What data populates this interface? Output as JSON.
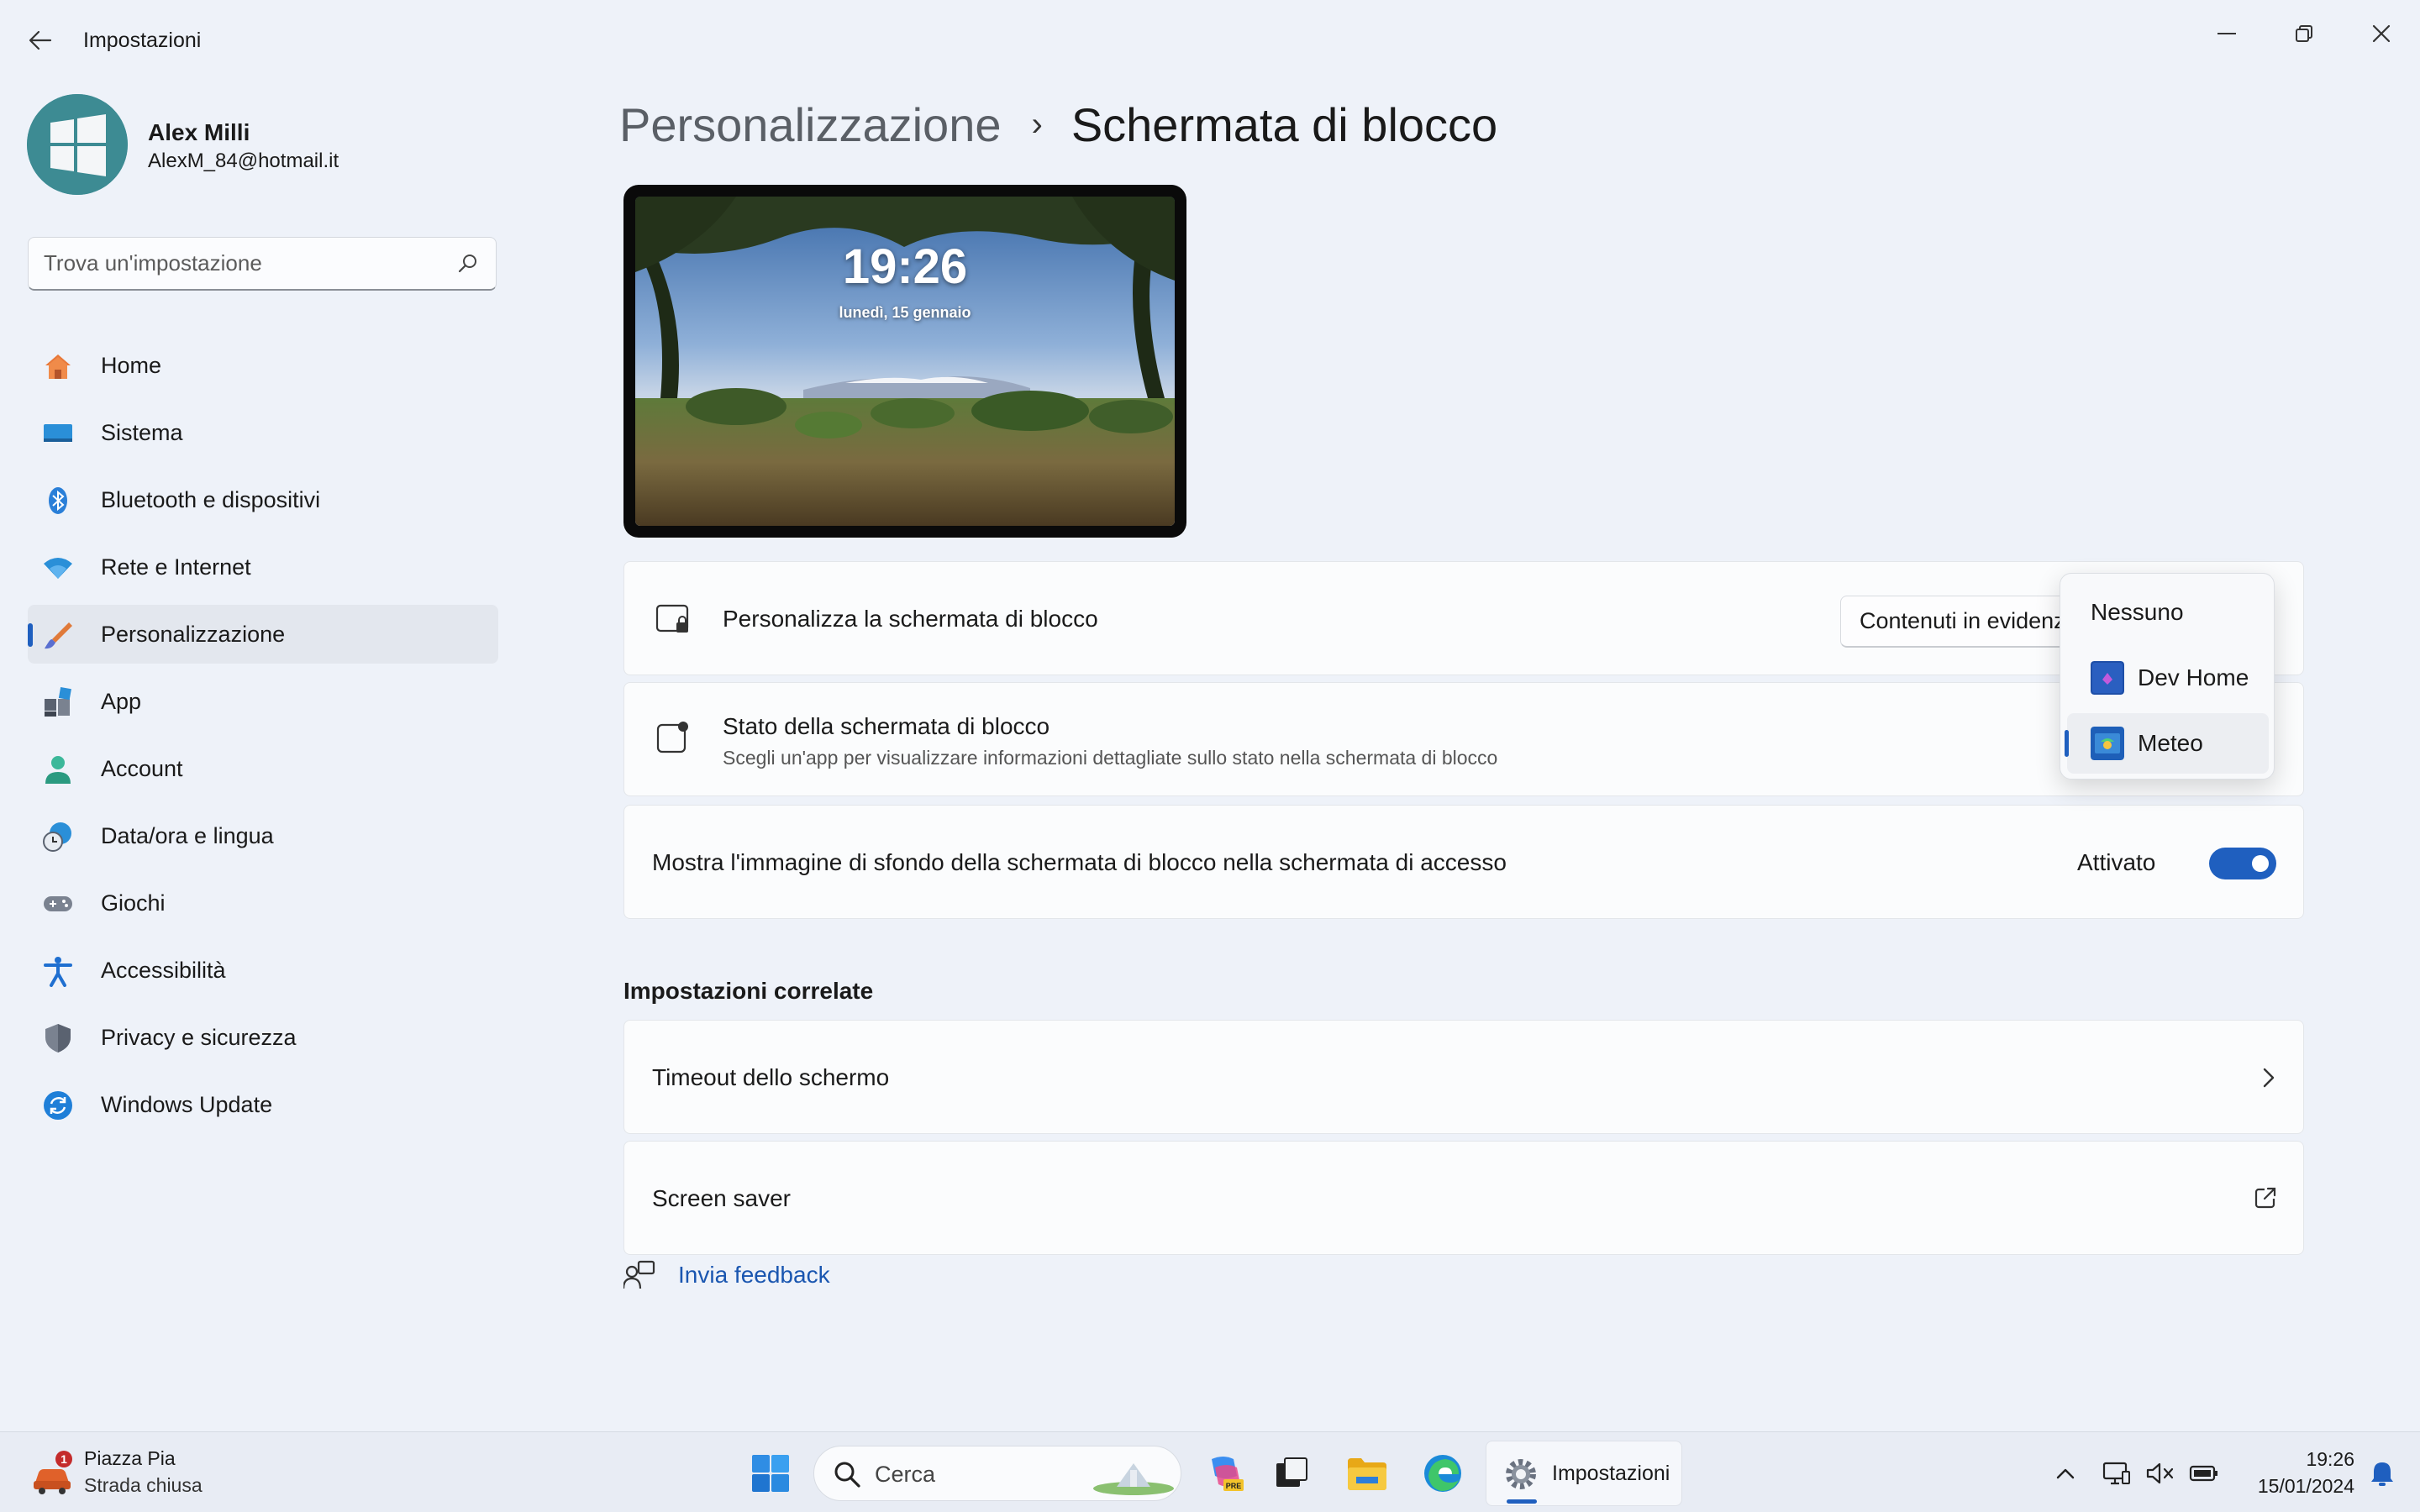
{
  "window": {
    "title": "Impostazioni",
    "controls": [
      "minimize",
      "restore",
      "close"
    ]
  },
  "profile": {
    "name": "Alex Milli",
    "email": "AlexM_84@hotmail.it"
  },
  "search": {
    "placeholder": "Trova un'impostazione"
  },
  "sidebar": {
    "items": [
      {
        "label": "Home",
        "icon": "home-icon"
      },
      {
        "label": "Sistema",
        "icon": "system-icon"
      },
      {
        "label": "Bluetooth e dispositivi",
        "icon": "bluetooth-icon"
      },
      {
        "label": "Rete e Internet",
        "icon": "wifi-icon"
      },
      {
        "label": "Personalizzazione",
        "icon": "brush-icon",
        "active": true
      },
      {
        "label": "App",
        "icon": "apps-icon"
      },
      {
        "label": "Account",
        "icon": "account-icon"
      },
      {
        "label": "Data/ora e lingua",
        "icon": "clock-globe-icon"
      },
      {
        "label": "Giochi",
        "icon": "gamepad-icon"
      },
      {
        "label": "Accessibilità",
        "icon": "accessibility-icon"
      },
      {
        "label": "Privacy e sicurezza",
        "icon": "shield-icon"
      },
      {
        "label": "Windows Update",
        "icon": "update-icon"
      }
    ]
  },
  "breadcrumb": {
    "parent": "Personalizzazione",
    "separator": "›",
    "current": "Schermata di blocco"
  },
  "preview": {
    "time": "19:26",
    "date": "lunedì, 15 gennaio"
  },
  "settings": {
    "personalize": {
      "title": "Personalizza la schermata di blocco",
      "value": "Contenuti in evidenza"
    },
    "status": {
      "title": "Stato della schermata di blocco",
      "subtitle": "Scegli un'app per visualizzare informazioni dettagliate sullo stato nella schermata di blocco"
    },
    "background": {
      "title": "Mostra l'immagine di sfondo della schermata di blocco nella schermata di accesso",
      "state_label": "Attivato",
      "on": true
    }
  },
  "dropdown": {
    "options": [
      {
        "label": "Nessuno"
      },
      {
        "label": "Dev Home",
        "icon": "dev-home-icon"
      },
      {
        "label": "Meteo",
        "icon": "weather-app-icon",
        "selected": true
      }
    ]
  },
  "related": {
    "heading": "Impostazioni correlate",
    "items": [
      {
        "label": "Timeout dello schermo",
        "icon": "chevron-right-icon"
      },
      {
        "label": "Screen saver",
        "icon": "external-link-icon"
      }
    ]
  },
  "feedback": {
    "label": "Invia feedback"
  },
  "taskbar": {
    "weather": {
      "line1": "Piazza Pia",
      "line2": "Strada chiusa",
      "badge": "1"
    },
    "search_label": "Cerca",
    "active_app": "Impostazioni",
    "time": "19:26",
    "date": "15/01/2024"
  },
  "colors": {
    "accent": "#1f5fbf",
    "background": "#eef2f9",
    "card": "#fbfcfd"
  }
}
